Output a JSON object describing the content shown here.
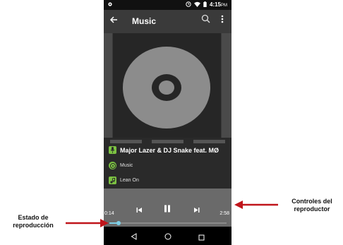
{
  "status_bar": {
    "time": "4:15",
    "ampm": "PM",
    "icons": [
      "notification-icon",
      "alarm-icon",
      "wifi-icon",
      "battery-icon"
    ]
  },
  "app_bar": {
    "title": "Music",
    "back_icon": "back-arrow-icon",
    "search_icon": "search-icon",
    "more_icon": "more-vert-icon"
  },
  "track": {
    "artist": "Major Lazer & DJ Snake feat. MØ",
    "album": "Music",
    "title": "Lean On"
  },
  "playback": {
    "elapsed": "0:14",
    "duration": "2:58",
    "progress_fraction": 0.08
  },
  "annotations": {
    "left": "Estado de reproducción",
    "right": "Controles del reproductor"
  },
  "colors": {
    "accent_green": "#7cc242",
    "seek_color": "#7fd0e8",
    "annotation_arrow": "#c0151b"
  }
}
